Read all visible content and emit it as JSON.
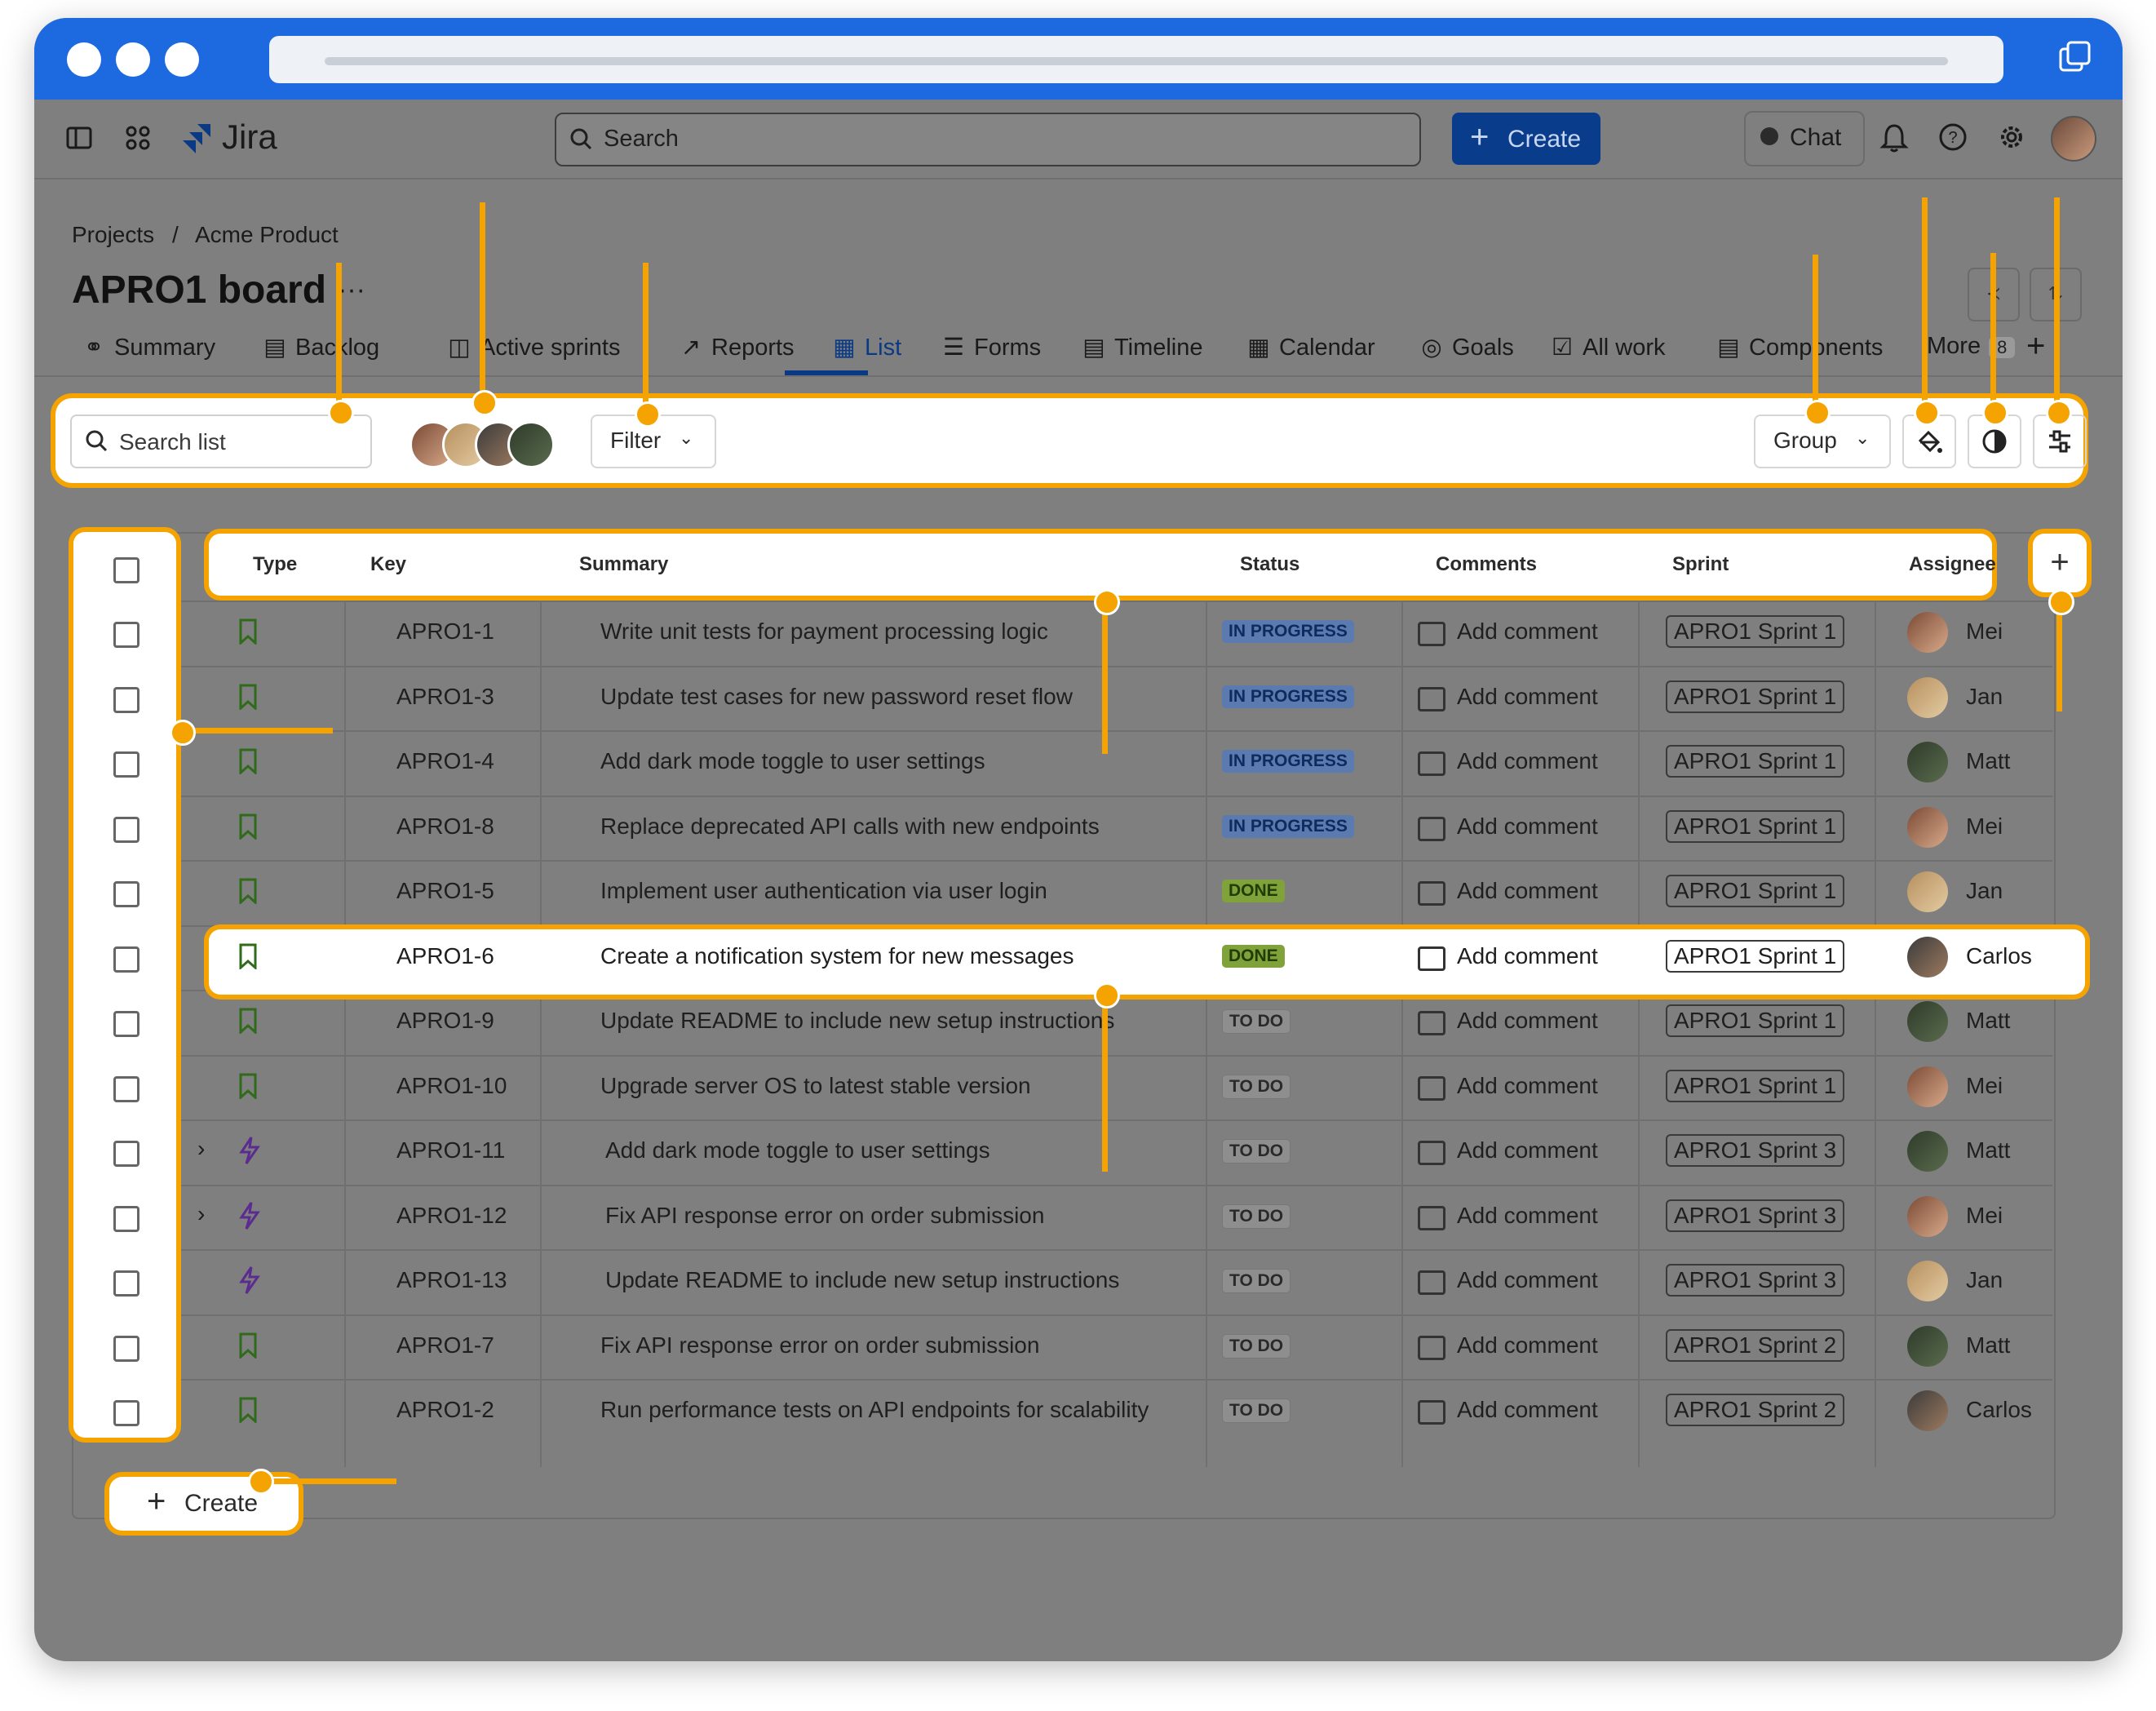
{
  "header": {
    "app_name": "Jira",
    "search_placeholder": "Search",
    "create_label": "Create",
    "chat_label": "Chat"
  },
  "breadcrumb": {
    "projects": "Projects",
    "separator": "/",
    "project": "Acme Product"
  },
  "page_title": "APRO1 board",
  "title_more": "···",
  "tabs": [
    {
      "label": "Summary",
      "icon": "globe-icon"
    },
    {
      "label": "Backlog",
      "icon": "backlog-icon"
    },
    {
      "label": "Active sprints",
      "icon": "board-icon"
    },
    {
      "label": "Reports",
      "icon": "chart-icon"
    },
    {
      "label": "List",
      "icon": "list-icon"
    },
    {
      "label": "Forms",
      "icon": "forms-icon"
    },
    {
      "label": "Timeline",
      "icon": "timeline-icon"
    },
    {
      "label": "Calendar",
      "icon": "calendar-icon"
    },
    {
      "label": "Goals",
      "icon": "goals-icon"
    },
    {
      "label": "All work",
      "icon": "all-work-icon"
    },
    {
      "label": "Components",
      "icon": "components-icon"
    },
    {
      "label": "More",
      "badge": "8"
    }
  ],
  "toolbar": {
    "search_placeholder": "Search list",
    "filter_label": "Filter",
    "group_label": "Group"
  },
  "table": {
    "columns": [
      "Type",
      "Key",
      "Summary",
      "Status",
      "Comments",
      "Sprint",
      "Assignee"
    ],
    "add_comment": "Add comment",
    "rows": [
      {
        "type": "story",
        "key": "APRO1-1",
        "summary": "Write unit tests for payment processing logic",
        "status": "IN PROGRESS",
        "sprint": "APRO1 Sprint 1",
        "assignee": "Mei"
      },
      {
        "type": "story",
        "key": "APRO1-3",
        "summary": "Update test cases for new password reset flow",
        "status": "IN PROGRESS",
        "sprint": "APRO1 Sprint 1",
        "assignee": "Jan"
      },
      {
        "type": "story",
        "key": "APRO1-4",
        "summary": "Add dark mode toggle to user settings",
        "status": "IN PROGRESS",
        "sprint": "APRO1 Sprint 1",
        "assignee": "Matt"
      },
      {
        "type": "story",
        "key": "APRO1-8",
        "summary": "Replace deprecated API calls with new endpoints",
        "status": "IN PROGRESS",
        "sprint": "APRO1 Sprint 1",
        "assignee": "Mei"
      },
      {
        "type": "story",
        "key": "APRO1-5",
        "summary": "Implement user authentication via user login",
        "status": "DONE",
        "sprint": "APRO1 Sprint 1",
        "assignee": "Jan"
      },
      {
        "type": "story",
        "key": "APRO1-6",
        "summary": "Create a notification system for new messages",
        "status": "DONE",
        "sprint": "APRO1 Sprint 1",
        "assignee": "Carlos"
      },
      {
        "type": "story",
        "key": "APRO1-9",
        "summary": "Update README to include new setup instructions",
        "status": "TO DO",
        "sprint": "APRO1 Sprint 1",
        "assignee": "Matt"
      },
      {
        "type": "story",
        "key": "APRO1-10",
        "summary": "Upgrade server OS to latest stable version",
        "status": "TO DO",
        "sprint": "APRO1 Sprint 1",
        "assignee": "Mei"
      },
      {
        "type": "epic",
        "key": "APRO1-11",
        "summary": "Add dark mode toggle to user settings",
        "status": "TO DO",
        "sprint": "APRO1 Sprint 3",
        "assignee": "Matt",
        "expandable": true
      },
      {
        "type": "epic",
        "key": "APRO1-12",
        "summary": "Fix API response error on order submission",
        "status": "TO DO",
        "sprint": "APRO1 Sprint 3",
        "assignee": "Mei",
        "expandable": true
      },
      {
        "type": "epic",
        "key": "APRO1-13",
        "summary": "Update README to include new setup instructions",
        "status": "TO DO",
        "sprint": "APRO1 Sprint 3",
        "assignee": "Jan"
      },
      {
        "type": "story",
        "key": "APRO1-7",
        "summary": "Fix API response error on order submission",
        "status": "TO DO",
        "sprint": "APRO1 Sprint 2",
        "assignee": "Matt"
      },
      {
        "type": "story",
        "key": "APRO1-2",
        "summary": "Run performance tests on API endpoints for scalability",
        "status": "TO DO",
        "sprint": "APRO1 Sprint 2",
        "assignee": "Carlos"
      }
    ]
  },
  "create_bottom_label": "Create",
  "colors": {
    "browser_bar": "#1d6ae0",
    "highlight": "#f4a300",
    "create_button": "#0a3c8c"
  }
}
